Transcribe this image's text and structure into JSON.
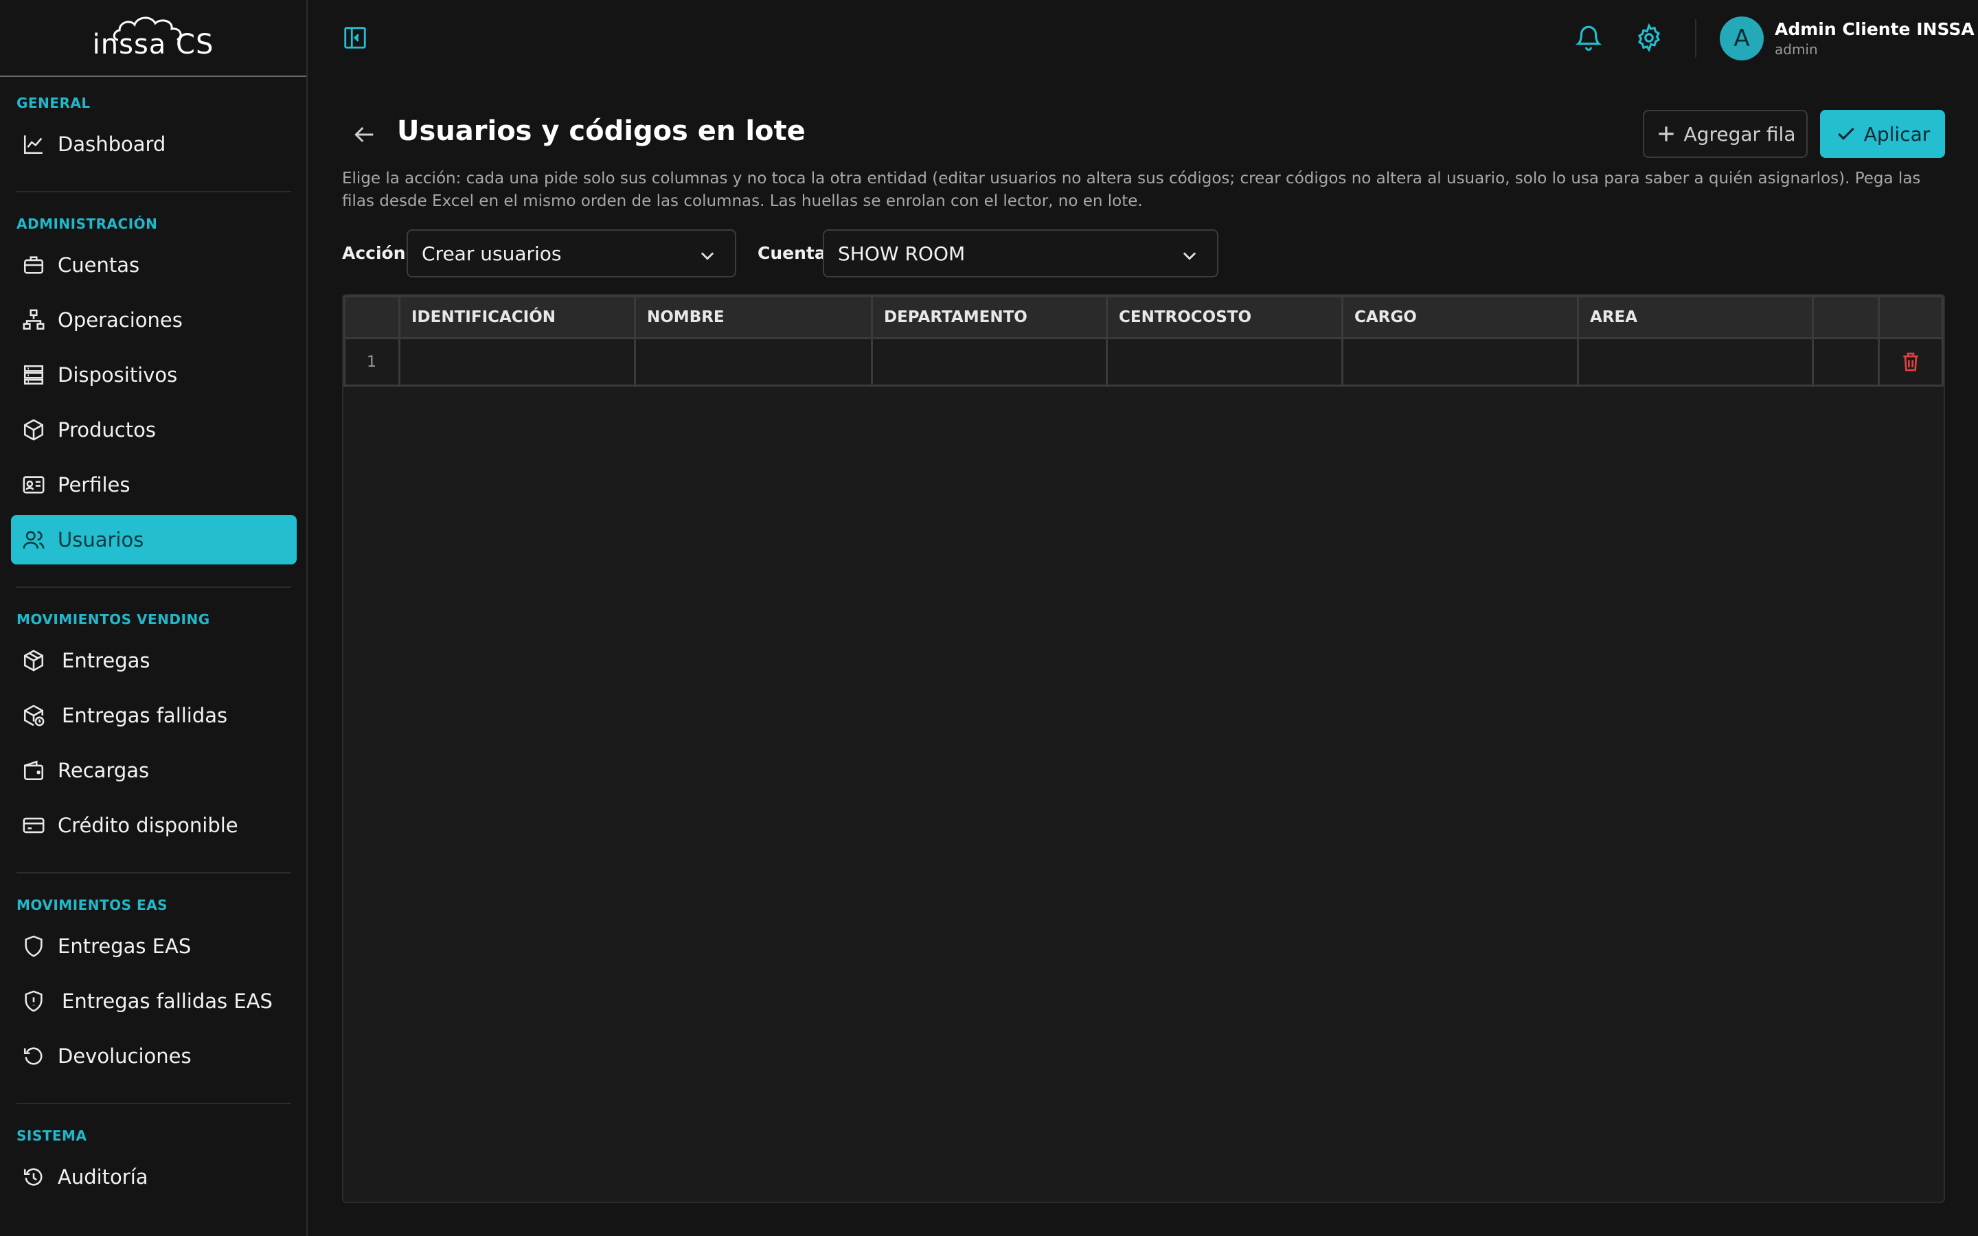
{
  "app": {
    "logo_text": "inssa CS"
  },
  "sidebar": {
    "sections": [
      {
        "label": "GENERAL"
      },
      {
        "label": "ADMINISTRACIÓN"
      },
      {
        "label": "MOVIMIENTOS VENDING"
      },
      {
        "label": "MOVIMIENTOS EAS"
      },
      {
        "label": "SISTEMA"
      }
    ],
    "items": [
      {
        "label": "Dashboard",
        "icon": "chart-line-icon"
      },
      {
        "label": "Cuentas",
        "icon": "briefcase-icon"
      },
      {
        "label": "Operaciones",
        "icon": "network-icon"
      },
      {
        "label": "Dispositivos",
        "icon": "server-icon"
      },
      {
        "label": "Productos",
        "icon": "box-icon"
      },
      {
        "label": "Perfiles",
        "icon": "id-card-icon"
      },
      {
        "label": "Usuarios",
        "icon": "users-icon",
        "active": true
      },
      {
        "label": "Entregas",
        "icon": "package-icon"
      },
      {
        "label": "Entregas fallidas",
        "icon": "package-clock-icon"
      },
      {
        "label": "Recargas",
        "icon": "wallet-icon"
      },
      {
        "label": "Crédito disponible",
        "icon": "credit-card-icon"
      },
      {
        "label": "Entregas EAS",
        "icon": "shield-icon"
      },
      {
        "label": "Entregas fallidas EAS",
        "icon": "shield-alert-icon"
      },
      {
        "label": "Devoluciones",
        "icon": "rotate-ccw-icon"
      },
      {
        "label": "Auditoría",
        "icon": "history-icon"
      }
    ]
  },
  "topbar": {
    "user": {
      "initial": "A",
      "name": "Admin Cliente INSSA",
      "role": "admin"
    }
  },
  "page": {
    "title": "Usuarios y códigos en lote",
    "add_row_label": "Agregar fila",
    "apply_label": "Aplicar",
    "description": "Elige la acción: cada una pide solo sus columnas y no toca la otra entidad (editar usuarios no altera sus códigos; crear códigos no altera al usuario, solo lo usa para saber a quién asignarlos). Pega las filas desde Excel en el mismo orden de las columnas. Las huellas se enrolan con el lector, no en lote.",
    "action_label": "Acción",
    "action_value": "Crear usuarios",
    "account_label": "Cuenta",
    "account_value": "SHOW ROOM"
  },
  "table": {
    "columns": [
      "IDENTIFICACIÓN",
      "NOMBRE",
      "DEPARTAMENTO",
      "CENTROCOSTO",
      "CARGO",
      "AREA"
    ],
    "rows": [
      {
        "num": "1"
      }
    ]
  },
  "colors": {
    "accent": "#23bfd1",
    "danger": "#e04040",
    "background": "#141414"
  }
}
